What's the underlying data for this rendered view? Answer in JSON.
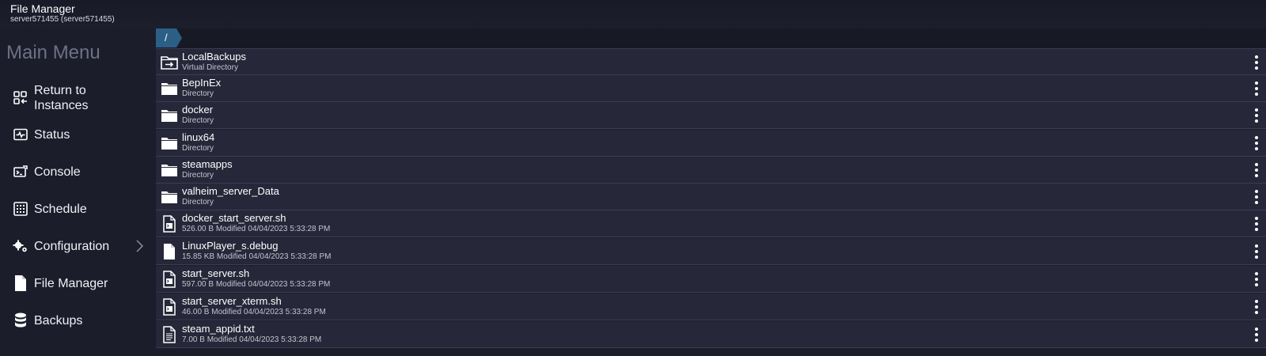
{
  "header": {
    "title": "File Manager",
    "subtitle": "server571455 (server571455)"
  },
  "sidebar": {
    "title": "Main Menu",
    "items": [
      {
        "label_line1": "Return to",
        "label_line2": "Instances",
        "icon": "return-to-instances-icon"
      },
      {
        "label": "Status",
        "icon": "status-pulse-icon"
      },
      {
        "label": "Console",
        "icon": "console-icon"
      },
      {
        "label": "Schedule",
        "icon": "schedule-icon"
      },
      {
        "label": "Configuration",
        "icon": "gears-icon",
        "has_submenu": true
      },
      {
        "label": "File Manager",
        "icon": "file-icon"
      },
      {
        "label": "Backups",
        "icon": "database-icon"
      }
    ]
  },
  "breadcrumb": {
    "root": "/"
  },
  "files": [
    {
      "name": "LocalBackups",
      "meta": "Virtual Directory",
      "icon": "virtual-folder-icon"
    },
    {
      "name": "BepInEx",
      "meta": "Directory",
      "icon": "folder-icon"
    },
    {
      "name": "docker",
      "meta": "Directory",
      "icon": "folder-icon"
    },
    {
      "name": "linux64",
      "meta": "Directory",
      "icon": "folder-icon"
    },
    {
      "name": "steamapps",
      "meta": "Directory",
      "icon": "folder-icon"
    },
    {
      "name": "valheim_server_Data",
      "meta": "Directory",
      "icon": "folder-icon"
    },
    {
      "name": "docker_start_server.sh",
      "meta": "526.00 B Modified 04/04/2023 5:33:28 PM",
      "icon": "script-file-icon"
    },
    {
      "name": "LinuxPlayer_s.debug",
      "meta": "15.85 KB Modified 04/04/2023 5:33:28 PM",
      "icon": "file-icon"
    },
    {
      "name": "start_server.sh",
      "meta": "597.00 B Modified 04/04/2023 5:33:28 PM",
      "icon": "script-file-icon"
    },
    {
      "name": "start_server_xterm.sh",
      "meta": "46.00 B Modified 04/04/2023 5:33:28 PM",
      "icon": "script-file-icon"
    },
    {
      "name": "steam_appid.txt",
      "meta": "7.00 B Modified 04/04/2023 5:33:28 PM",
      "icon": "text-file-icon"
    }
  ],
  "colors": {
    "background": "#1b1d2b",
    "row": "#262839",
    "breadcrumb": "#2b5f86",
    "menu_title": "#6e7086"
  }
}
